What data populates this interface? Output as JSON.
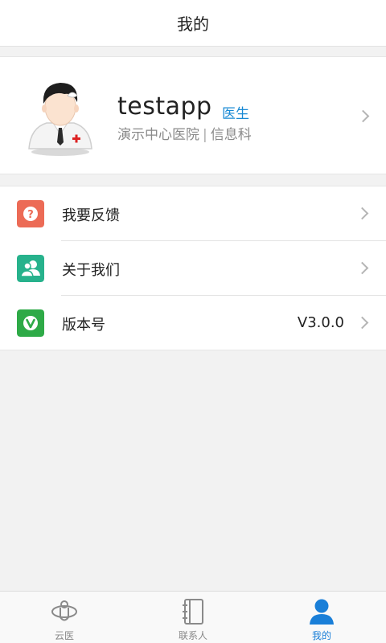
{
  "header": {
    "title": "我的"
  },
  "profile": {
    "username": "testapp",
    "role": "医生",
    "hospital": "演示中心医院",
    "separator": "|",
    "department": "信息科"
  },
  "menu": {
    "items": [
      {
        "label": "我要反馈",
        "icon": "feedback-question-icon",
        "color": "#ec6b56"
      },
      {
        "label": "关于我们",
        "icon": "about-us-people-icon",
        "color": "#27b28c"
      },
      {
        "label": "版本号",
        "value": "V3.0.0",
        "icon": "version-v-icon",
        "color": "#2eaa47"
      }
    ]
  },
  "tabbar": {
    "tabs": [
      {
        "label": "云医",
        "icon": "cloud-doctor-icon",
        "active": false
      },
      {
        "label": "联系人",
        "icon": "contacts-book-icon",
        "active": false
      },
      {
        "label": "我的",
        "icon": "user-profile-icon",
        "active": true
      }
    ]
  },
  "colors": {
    "accent": "#1a7fd8",
    "role": "#1a8ad4",
    "background": "#f2f2f2"
  }
}
